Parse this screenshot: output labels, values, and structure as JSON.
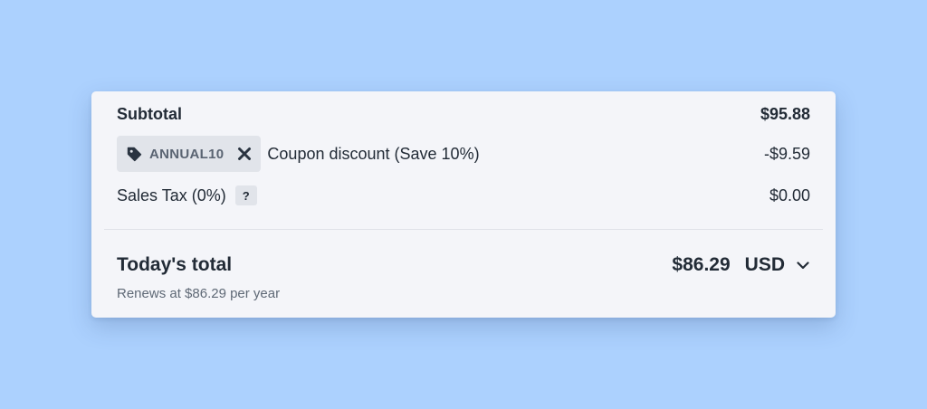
{
  "summary": {
    "subtotal_label": "Subtotal",
    "subtotal_value": "$95.88",
    "coupon": {
      "code": "ANNUAL10",
      "label": "Coupon discount (Save 10%)",
      "value": "-$9.59",
      "tag_icon": "tag-icon",
      "remove_icon": "close-icon"
    },
    "tax_label": "Sales Tax (0%)",
    "tax_help": "?",
    "tax_value": "$0.00",
    "total_label": "Today's total",
    "total_amount": "$86.29",
    "currency": "USD",
    "currency_icon": "chevron-down-icon",
    "renews_text": "Renews at $86.29 per year"
  },
  "colors": {
    "background": "#acd1fe",
    "card": "#f4f5f9",
    "chip": "#e1e4ea",
    "text": "#222b36",
    "muted_text": "#5f6976"
  }
}
